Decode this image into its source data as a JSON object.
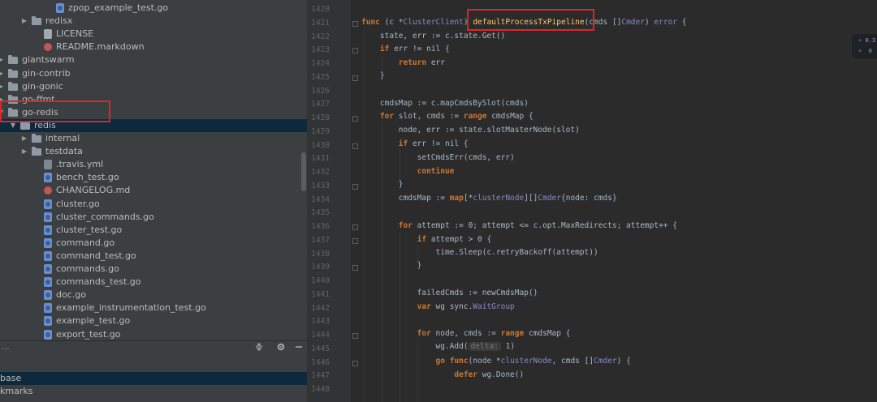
{
  "project_tree": {
    "items": [
      {
        "label": "zpop_example_test.go",
        "kind": "go"
      },
      {
        "label": "redisx",
        "kind": "folder",
        "state": "collapsed"
      },
      {
        "label": "LICENSE",
        "kind": "txt"
      },
      {
        "label": "README.markdown",
        "kind": "md"
      },
      {
        "label": "giantswarm",
        "kind": "folder",
        "state": "collapsed"
      },
      {
        "label": "gin-contrib",
        "kind": "folder",
        "state": "collapsed"
      },
      {
        "label": "gin-gonic",
        "kind": "folder",
        "state": "collapsed"
      },
      {
        "label": "go-ffmt",
        "kind": "folder",
        "state": "collapsed"
      },
      {
        "label": "go-redis",
        "kind": "folder",
        "state": "expanded"
      },
      {
        "label": "redis",
        "kind": "folder",
        "state": "expanded",
        "selected": true
      },
      {
        "label": "internal",
        "kind": "folder",
        "state": "collapsed"
      },
      {
        "label": "testdata",
        "kind": "folder",
        "state": "collapsed"
      },
      {
        "label": ".travis.yml",
        "kind": "yml"
      },
      {
        "label": "bench_test.go",
        "kind": "go"
      },
      {
        "label": "CHANGELOG.md",
        "kind": "md"
      },
      {
        "label": "cluster.go",
        "kind": "go"
      },
      {
        "label": "cluster_commands.go",
        "kind": "go"
      },
      {
        "label": "cluster_test.go",
        "kind": "go"
      },
      {
        "label": "command.go",
        "kind": "go"
      },
      {
        "label": "command_test.go",
        "kind": "go"
      },
      {
        "label": "commands.go",
        "kind": "go"
      },
      {
        "label": "commands_test.go",
        "kind": "go"
      },
      {
        "label": "doc.go",
        "kind": "go"
      },
      {
        "label": "example_instrumentation_test.go",
        "kind": "go"
      },
      {
        "label": "example_test.go",
        "kind": "go"
      },
      {
        "label": "export_test.go",
        "kind": "go"
      }
    ]
  },
  "tool_window": {
    "header_dots": "...",
    "items": [
      {
        "label": "base",
        "selected": true
      },
      {
        "label": "kmarks",
        "selected": false
      },
      {
        "label": "",
        "selected": false
      }
    ]
  },
  "editor": {
    "line_numbers": [
      "1420",
      "1421",
      "1422",
      "1423",
      "1424",
      "1425",
      "1426",
      "1427",
      "1428",
      "1429",
      "1430",
      "1431",
      "1432",
      "1433",
      "1434",
      "1435",
      "1436",
      "1437",
      "1438",
      "1439",
      "1440",
      "1441",
      "1442",
      "1443",
      "1444",
      "1445",
      "1446",
      "1447",
      "1448"
    ],
    "hint_delta": "delta:",
    "hint_node": "node: ",
    "badge": {
      "line1": "0.3",
      "line2": "0"
    }
  }
}
